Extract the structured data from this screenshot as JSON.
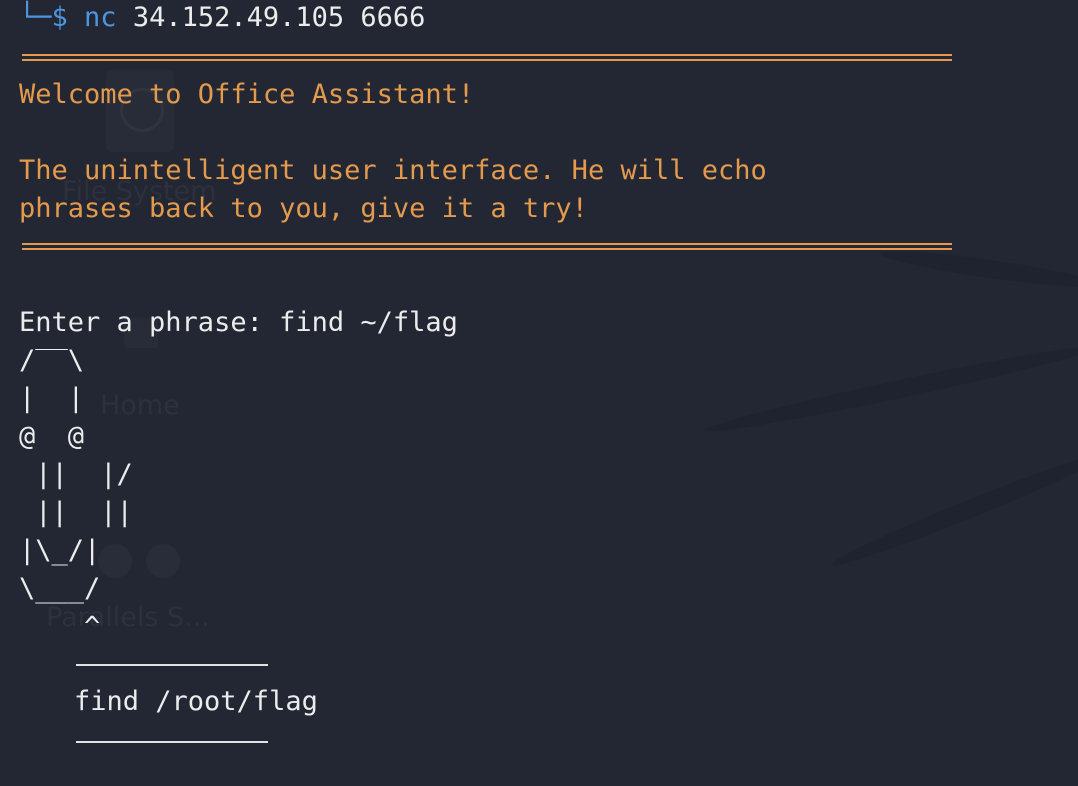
{
  "desktop": {
    "icons": [
      {
        "label": "File System"
      },
      {
        "label": "Home"
      },
      {
        "label": "Parallels S..."
      }
    ]
  },
  "terminal": {
    "prompt_symbol": "$",
    "command_name": "nc",
    "command_args": " 34.152.49.105 6666",
    "welcome": "Welcome to Office Assistant!",
    "description_line1": "The unintelligent user interface. He will echo",
    "description_line2": "phrases back to you, give it a try!",
    "input_prompt": "Enter a phrase: find ~/flag",
    "ascii_art": [
      "/‾‾\\",
      "|  |",
      "@  @",
      " ||  |/",
      " ||  ||",
      "|\\_/|",
      "\\___/",
      "    ^"
    ],
    "echo_output": "find /root/flag"
  },
  "colors": {
    "background": "#222733",
    "accent_orange": "#e49a4c",
    "prompt_blue": "#4e95e0",
    "text": "#ececec"
  }
}
